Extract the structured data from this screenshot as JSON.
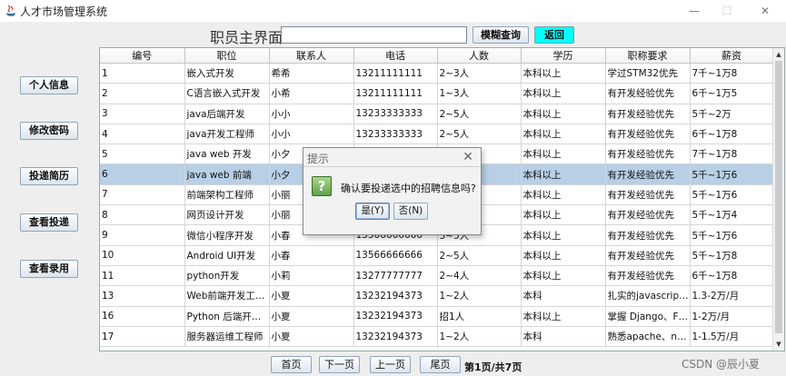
{
  "window": {
    "title": "人才市场管理系统"
  },
  "header": {
    "page_title": "职员主界面",
    "search_value": "",
    "fuzzy_search_label": "模糊查询",
    "back_label": "返回"
  },
  "sidebar": {
    "items": [
      {
        "label": "个人信息"
      },
      {
        "label": "修改密码"
      },
      {
        "label": "投递简历"
      },
      {
        "label": "查看投递"
      },
      {
        "label": "查看录用"
      }
    ]
  },
  "table": {
    "columns": [
      "编号",
      "职位",
      "联系人",
      "电话",
      "人数",
      "学历",
      "职称要求",
      "薪资"
    ],
    "selected_index": 5,
    "rows": [
      [
        "1",
        "嵌入式开发",
        "希希",
        "13211111111",
        "2~3人",
        "本科以上",
        "学过STM32优先",
        "7千~1万8"
      ],
      [
        "2",
        "C语言嵌入式开发",
        "小希",
        "13211111111",
        "1~3人",
        "本科以上",
        "有开发经验优先",
        "6千~1万5"
      ],
      [
        "3",
        "java后端开发",
        "小小",
        "13233333333",
        "2~5人",
        "本科以上",
        "有开发经验优先",
        "5千~2万"
      ],
      [
        "4",
        "java开发工程师",
        "小小",
        "13233333333",
        "2~5人",
        "本科以上",
        "有开发经验优先",
        "6千~1万8"
      ],
      [
        "5",
        "java web 开发",
        "小夕",
        "",
        "",
        "本科以上",
        "有开发经验优先",
        "7千~1万8"
      ],
      [
        "6",
        "java web 前端",
        "小夕",
        "",
        "",
        "本科以上",
        "有开发经验优先",
        "5千~1万6"
      ],
      [
        "7",
        "前端架构工程师",
        "小丽",
        "",
        "",
        "本科以上",
        "有开发经验优先",
        "5千~1万6"
      ],
      [
        "8",
        "网页设计开发",
        "小丽",
        "",
        "",
        "本科以上",
        "有开发经验优先",
        "5千~1万4"
      ],
      [
        "9",
        "微信小程序开发",
        "小春",
        "13566666666",
        "3~5人",
        "本科以上",
        "有开发经验优先",
        "5千~1万6"
      ],
      [
        "10",
        "Android UI开发",
        "小春",
        "13566666666",
        "2~5人",
        "本科以上",
        "有开发经验优先",
        "5千~1万8"
      ],
      [
        "11",
        "python开发",
        "小莉",
        "13277777777",
        "2~4人",
        "本科以上",
        "有开发经验优先",
        "6千~1万8"
      ],
      [
        "13",
        "Web前端开发工程师",
        "小夏",
        "13232194373",
        "1~2人",
        "本科",
        "扎实的javascript/HT...",
        "1.3-2万/月"
      ],
      [
        "16",
        "Python 后端开发工程...",
        "小夏",
        "13232194373",
        "招1人",
        "本科以上",
        "掌握 Django、Flask...",
        "1-2万/月"
      ],
      [
        "17",
        "服务器运维工程师",
        "小夏",
        "13232194373",
        "1~2人",
        "本科",
        "熟悉apache、nginx...",
        "1-1.5万/月"
      ]
    ]
  },
  "pagination": {
    "first_label": "首页",
    "next_label": "下一页",
    "prev_label": "上一页",
    "last_label": "尾页",
    "page_info": "第1页/共7页"
  },
  "dialog": {
    "title": "提示",
    "message": "确认要投递选中的招聘信息吗?",
    "yes_label": "是(Y)",
    "no_label": "否(N)",
    "icon": "question-icon"
  },
  "watermark": "CSDN @辰小夏",
  "colors": {
    "selected_row": "#b8cfe5",
    "back_button": "#00ffff"
  }
}
